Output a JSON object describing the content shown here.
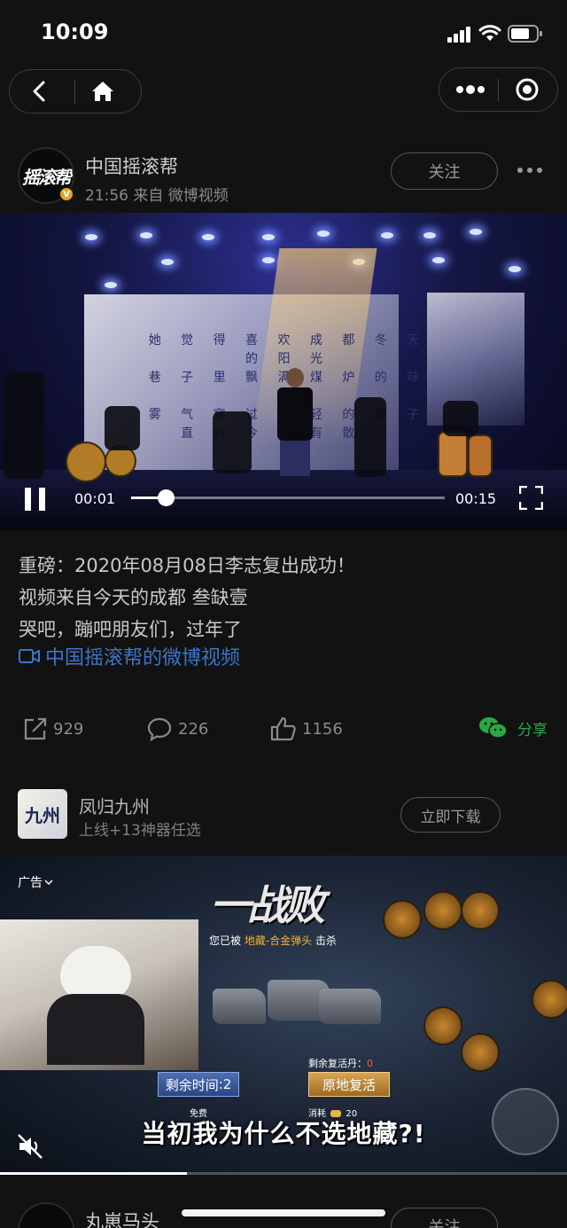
{
  "status": {
    "time": "10:09"
  },
  "post": {
    "author": "中国摇滚帮",
    "avatar_text": "摇滚帮",
    "meta": "21:56 来自 微博视频",
    "follow_label": "关注",
    "video": {
      "current_time": "00:01",
      "total_time": "00:15",
      "progress": 0.11,
      "lyrics": [
        "她 觉 得 喜 欢 成 都 冬 天 的 阳 光",
        "巷 子 里 飘 满 煤 炉 的 味 道",
        "雾 气 穿 过 年 轻 的 脖 子",
        "直 到 今 没 有 散 去"
      ]
    },
    "text_lines": [
      "重磅：2020年08月08日李志复出成功！",
      "视频来自今天的成都 叁缺壹",
      "哭吧，蹦吧朋友们，过年了"
    ],
    "video_link": "中国摇滚帮的微博视频",
    "actions": {
      "reposts": "929",
      "comments": "226",
      "likes": "1156",
      "share_label": "分享"
    }
  },
  "ad": {
    "title": "凤归九州",
    "subtitle": "上线+13神器任选",
    "icon_text": "九州",
    "download_label": "立即下载",
    "ad_label": "广告",
    "game_title": "一战败",
    "kill_prefix": "您已被",
    "kill_target": "地藏-合金弹头",
    "kill_suffix": "击杀",
    "time_left_label": "剩余时间",
    "time_left_value": ":2",
    "revive_label": "剩余复活丹：",
    "revive_count": "0",
    "revive_button": "原地复活",
    "free_label": "免费",
    "cost_label": "消耗",
    "cost_value": "20",
    "caption": "当初我为什么不选地藏?!",
    "progress": 0.33
  },
  "next_post": {
    "author": "丸崽马头",
    "follow_label": "关注"
  },
  "colors": {
    "background": "#121212",
    "link": "#3e74c9",
    "wechat": "#2ca745"
  }
}
